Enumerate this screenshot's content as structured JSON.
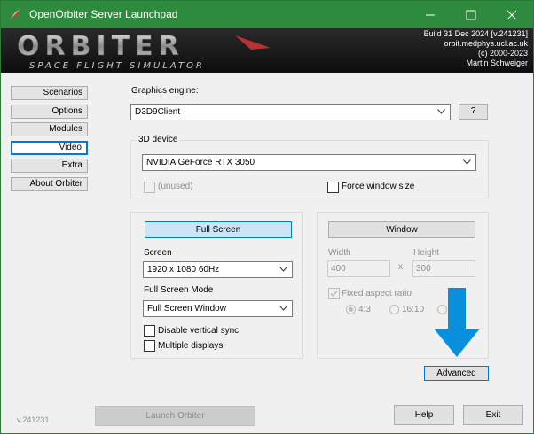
{
  "titlebar": {
    "title": "OpenOrbiter Server Launchpad",
    "minimize_icon": "minimize-icon",
    "maximize_icon": "maximize-icon",
    "close_icon": "close-icon"
  },
  "banner": {
    "logo_text": "ORBITER",
    "logo_subtitle": "SPACE FLIGHT SIMULATOR",
    "build_lines": [
      "Build 31 Dec 2024 [v.241231]",
      "orbit.medphys.ucl.ac.uk",
      "(c) 2000-2023",
      "Martin Schweiger"
    ]
  },
  "nav": {
    "items": [
      "Scenarios",
      "Options",
      "Modules",
      "Video",
      "Extra",
      "About Orbiter"
    ],
    "active": "Video"
  },
  "video": {
    "graphics_engine_label": "Graphics engine:",
    "graphics_engine_value": "D3D9Client",
    "help_button": "?",
    "device_group_title": "3D device",
    "device_value": "NVIDIA GeForce RTX 3050",
    "unused_label": "(unused)",
    "force_window_label": "Force window size",
    "fullscreen_button": "Full Screen",
    "screen_label": "Screen",
    "screen_value": "1920 x 1080 60Hz",
    "fullscreen_mode_label": "Full Screen Mode",
    "fullscreen_mode_value": "Full Screen Window",
    "vsync_label": "Disable vertical sync.",
    "multi_display_label": "Multiple displays",
    "window_button": "Window",
    "width_label": "Width",
    "height_label": "Height",
    "width_value": "400",
    "height_value": "300",
    "times_sign": "x",
    "fixed_aspect_label": "Fixed aspect ratio",
    "aspect_options": [
      "4:3",
      "16:10"
    ],
    "aspect_selected": "4:3",
    "advanced_button": "Advanced"
  },
  "footer": {
    "version": "v.241231",
    "launch_button": "Launch Orbiter",
    "help_button": "Help",
    "exit_button": "Exit"
  },
  "colors": {
    "titlebar": "#2e8b3e",
    "accent": "#0078d7",
    "annotation_arrow": "#0a8fdc"
  }
}
